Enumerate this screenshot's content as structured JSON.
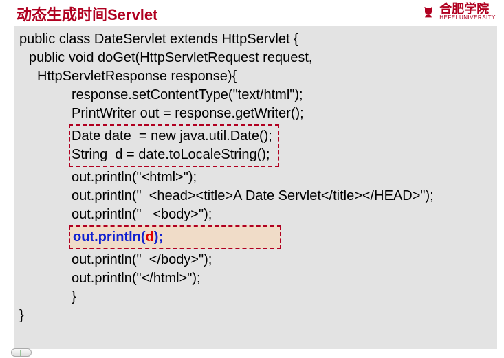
{
  "header": {
    "title": "动态生成时间Servlet",
    "logo_text": "合肥学院",
    "logo_sub": "HEFEI UNIVERSITY"
  },
  "code": {
    "l1": "public class DateServlet extends HttpServlet {",
    "l2": "public void doGet(HttpServletRequest request,",
    "l3": "HttpServletResponse response){",
    "l4": "response.setContentType(\"text/html\");",
    "l5": "PrintWriter out = response.getWriter();",
    "box1_l1": "Date date  = new java.util.Date();",
    "box1_l2": "String  d = date.toLocaleString();",
    "l6": "out.println(\"<html>\");",
    "l7": "out.println(\"  <head><title>A Date Servlet</title></HEAD>\");",
    "l8": "out.println(\"   <body>\");",
    "box2_pre": "out.println(",
    "box2_mid": "d",
    "box2_post": ");",
    "l9": "out.println(\"  </body>\");",
    "l10": "out.println(\"</html>\");",
    "l11": "}",
    "l12": "}"
  }
}
